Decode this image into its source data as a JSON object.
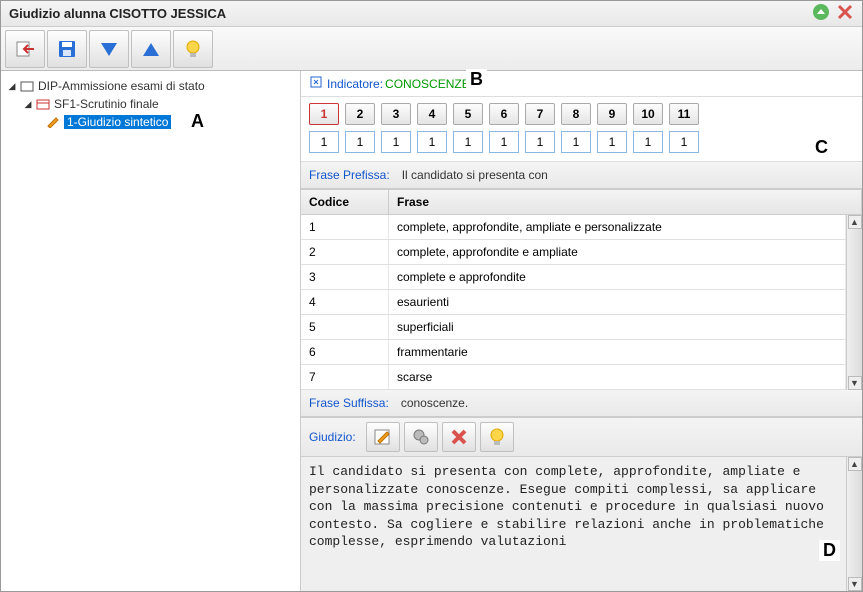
{
  "title": "Giudizio alunna CISOTTO JESSICA",
  "toolbar": {
    "back_icon": "back",
    "save_icon": "save",
    "down_icon": "down",
    "up_icon": "up",
    "bulb_icon": "bulb"
  },
  "tree": {
    "root": {
      "label": "DIP-Ammissione esami di stato"
    },
    "child1": {
      "label": "SF1-Scrutinio finale"
    },
    "leaf": {
      "label": "1-Giudizio sintetico"
    }
  },
  "annotations": {
    "A": "A",
    "B": "B",
    "C": "C",
    "D": "D"
  },
  "indicator": {
    "label": "Indicatore:",
    "value": "CONOSCENZE"
  },
  "tabs": [
    "1",
    "2",
    "3",
    "4",
    "5",
    "6",
    "7",
    "8",
    "9",
    "10",
    "11"
  ],
  "inputs": [
    "1",
    "1",
    "1",
    "1",
    "1",
    "1",
    "1",
    "1",
    "1",
    "1",
    "1"
  ],
  "frase_prefissa": {
    "label": "Frase Prefissa:",
    "text": "Il candidato si presenta con"
  },
  "table": {
    "headers": {
      "codice": "Codice",
      "frase": "Frase"
    },
    "rows": [
      {
        "codice": "1",
        "frase": "complete, approfondite, ampliate e personalizzate"
      },
      {
        "codice": "2",
        "frase": "complete, approfondite e ampliate"
      },
      {
        "codice": "3",
        "frase": "complete e approfondite"
      },
      {
        "codice": "4",
        "frase": "esaurienti"
      },
      {
        "codice": "5",
        "frase": "superficiali"
      },
      {
        "codice": "6",
        "frase": "frammentarie"
      },
      {
        "codice": "7",
        "frase": "scarse"
      }
    ]
  },
  "frase_suffissa": {
    "label": "Frase Suffissa:",
    "text": "conoscenze."
  },
  "giudizio": {
    "label": "Giudizio:"
  },
  "output_text": "Il candidato si presenta con complete, approfondite, ampliate e personalizzate conoscenze.  Esegue compiti complessi, sa applicare con la massima precisione contenuti e procedure in qualsiasi nuovo contesto.  Sa cogliere e stabilire relazioni anche in problematiche complesse, esprimendo valutazioni"
}
